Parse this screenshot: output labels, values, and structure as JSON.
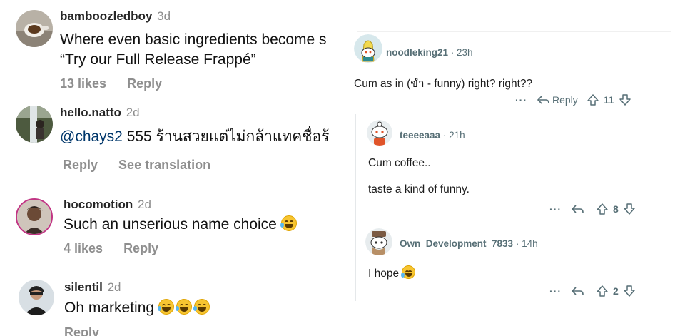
{
  "instagram": {
    "comments": [
      {
        "username": "bamboozledboy",
        "time": "3d",
        "text_line1": "Where even basic ingredients become s",
        "text_line2": "“Try our Full Release Frappé”",
        "likes": "13 likes",
        "reply": "Reply"
      },
      {
        "username": "hello.natto",
        "time": "2d",
        "mention": "@chays2",
        "text": " 555 ร้านสวยแต่ไม่กล้าแทคชื่อร้",
        "reply": "Reply",
        "translation": "See translation"
      },
      {
        "username": "hocomotion",
        "time": "2d",
        "text": "Such an unserious name choice",
        "likes": "4 likes",
        "reply": "Reply"
      },
      {
        "username": "silentil",
        "time": "2d",
        "text": "Oh marketing",
        "reply": "Reply"
      }
    ]
  },
  "reddit": {
    "comments": [
      {
        "username": "noodleking21",
        "time": "· 23h",
        "text": "Cum as in (ขำ - funny) right? right??",
        "more": "···",
        "reply": "Reply",
        "votes": "11"
      },
      {
        "username": "teeeeaaa",
        "time": "· 21h",
        "text_line1": "Cum coffee..",
        "text_line2": "taste a kind of funny.",
        "more": "···",
        "votes": "8"
      },
      {
        "username": "Own_Development_7833",
        "time": "· 14h",
        "text": "I hope",
        "more": "···",
        "votes": "2"
      }
    ],
    "colors": {
      "meta": "#576f76",
      "text": "#1c1c1c"
    }
  },
  "icons": [
    "coffee-avatar",
    "waterfall-avatar",
    "portrait-avatar",
    "selfie-avatar",
    "banana-snoo-avatar",
    "snoo-avatar",
    "hat-snoo-avatar",
    "reply-arrow-icon",
    "upvote-icon",
    "downvote-icon",
    "more-icon",
    "laughing-emoji"
  ]
}
